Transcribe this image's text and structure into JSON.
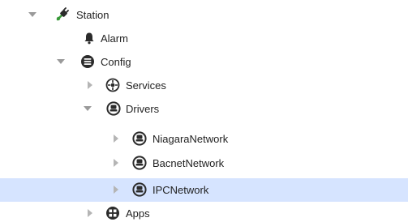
{
  "tree": {
    "nodes": [
      {
        "label": "Station",
        "icon": "station-plug-icon",
        "toggle": "expanded"
      },
      {
        "label": "Alarm",
        "icon": "bell-icon",
        "toggle": "none"
      },
      {
        "label": "Config",
        "icon": "database-icon",
        "toggle": "expanded"
      },
      {
        "label": "Services",
        "icon": "services-icon",
        "toggle": "collapsed"
      },
      {
        "label": "Drivers",
        "icon": "driver-icon",
        "toggle": "expanded"
      },
      {
        "label": "NiagaraNetwork",
        "icon": "network-icon",
        "toggle": "collapsed"
      },
      {
        "label": "BacnetNetwork",
        "icon": "network-icon",
        "toggle": "collapsed"
      },
      {
        "label": "IPCNetwork",
        "icon": "network-icon",
        "toggle": "collapsed",
        "selected": true
      },
      {
        "label": "Apps",
        "icon": "apps-icon",
        "toggle": "collapsed"
      }
    ]
  },
  "colors": {
    "selection": "#d6e4ff",
    "icon_dark": "#2b2b2b",
    "toggle_arrow": "#9a9a9a",
    "station_green": "#3a9a3a"
  }
}
